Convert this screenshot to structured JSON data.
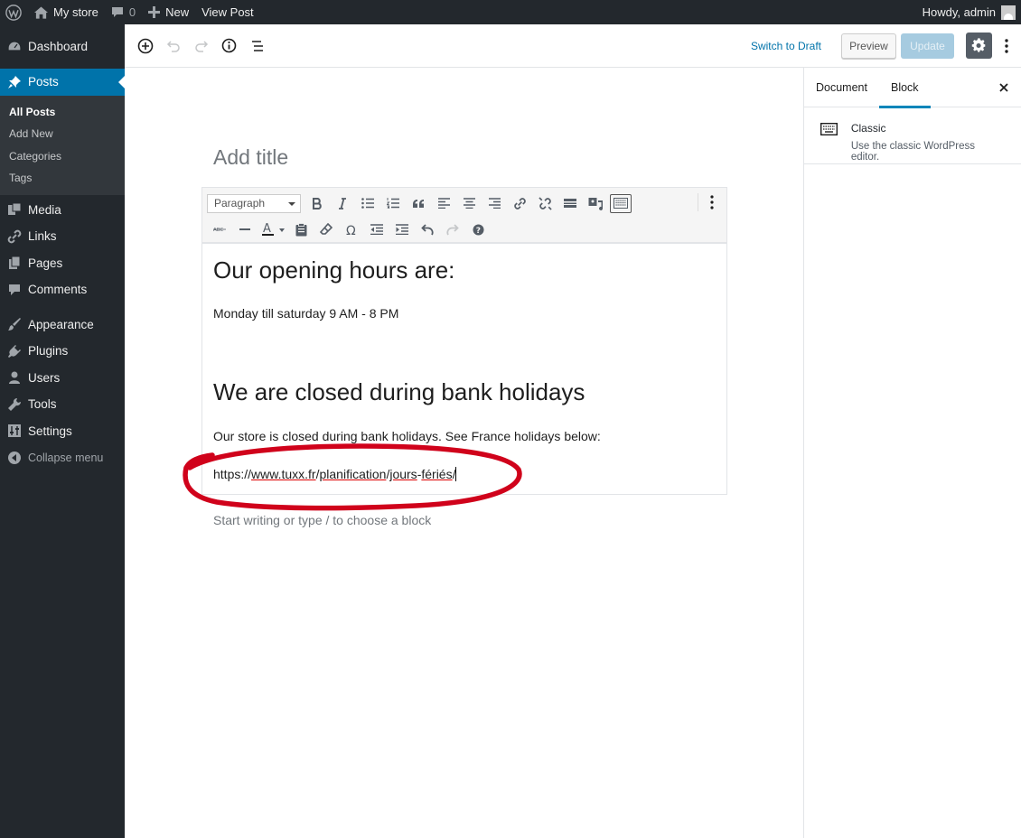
{
  "admin_bar": {
    "site_name": "My store",
    "comments_count": "0",
    "new_label": "New",
    "view_post_label": "View Post",
    "howdy": "Howdy, admin"
  },
  "sidebar": {
    "items": [
      {
        "label": "Dashboard",
        "icon": "dashboard-icon"
      },
      {
        "label": "Posts",
        "icon": "pushpin-icon"
      },
      {
        "label": "Media",
        "icon": "media-icon"
      },
      {
        "label": "Links",
        "icon": "link-icon"
      },
      {
        "label": "Pages",
        "icon": "pages-icon"
      },
      {
        "label": "Comments",
        "icon": "comment-icon"
      },
      {
        "label": "Appearance",
        "icon": "brush-icon"
      },
      {
        "label": "Plugins",
        "icon": "plug-icon"
      },
      {
        "label": "Users",
        "icon": "user-icon"
      },
      {
        "label": "Tools",
        "icon": "wrench-icon"
      },
      {
        "label": "Settings",
        "icon": "settings-icon"
      }
    ],
    "posts_submenu": [
      "All Posts",
      "Add New",
      "Categories",
      "Tags"
    ],
    "collapse_label": "Collapse menu"
  },
  "header": {
    "switch_to_draft": "Switch to Draft",
    "preview": "Preview",
    "update": "Update"
  },
  "settings_panel": {
    "tabs": [
      "Document",
      "Block"
    ],
    "active_tab": "Block",
    "block_title": "Classic",
    "block_description": "Use the classic WordPress editor."
  },
  "editor": {
    "title_placeholder": "Add title",
    "format_select": "Paragraph",
    "heading1": "Our opening hours are:",
    "paragraph1": "Monday till saturday 9 AM - 8 PM",
    "heading2": "We are closed during bank holidays",
    "paragraph2": "Our store is closed during bank holidays. See France holidays below:",
    "url_parts": [
      "https://",
      "www.tuxx.fr",
      "/",
      "planification",
      "/",
      "jours",
      "-",
      "fériés",
      "/"
    ],
    "next_block_placeholder": "Start writing or type / to choose a block"
  },
  "colors": {
    "admin_dark": "#23282d",
    "accent_blue": "#0073aa",
    "annotation_red": "#d0021b"
  }
}
